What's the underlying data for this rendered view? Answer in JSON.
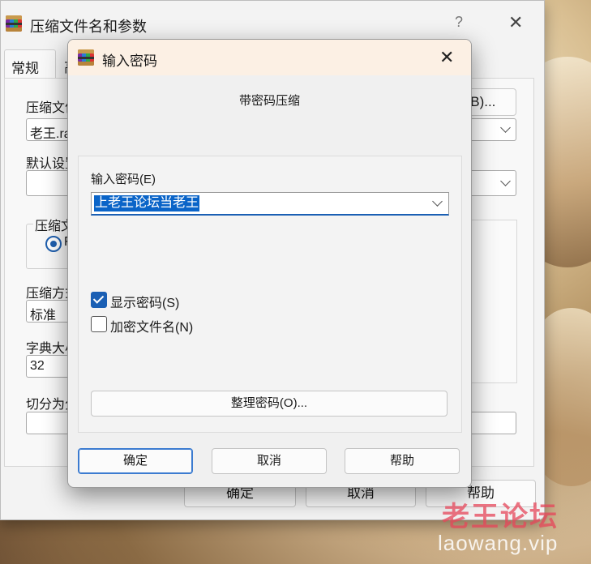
{
  "back_window": {
    "title": "压缩文件名和参数",
    "help_glyph": "?",
    "close_glyph": "✕",
    "tabs": [
      {
        "label": "常规",
        "active": true
      },
      {
        "label": "高",
        "active": false
      }
    ],
    "archive_name_label": "压缩文件",
    "archive_name_value": "老王.ra",
    "browse_button": "(B)...",
    "default_profile_label": "默认设置",
    "format_group_label": "压缩文",
    "format_option_fragment": "F",
    "method_label": "压缩方式",
    "method_value": "标准",
    "dict_label": "字典大小",
    "dict_value": "32",
    "split_label": "切分为分",
    "buttons": {
      "ok": "确定",
      "cancel": "取消",
      "help": "帮助"
    }
  },
  "dialog": {
    "title": "输入密码",
    "close_glyph": "✕",
    "heading": "带密码压缩",
    "password_label": "输入密码(E)",
    "password_value": "上老王论坛当老王",
    "show_password_label": "显示密码(S)",
    "show_password_checked": true,
    "encrypt_names_label": "加密文件名(N)",
    "encrypt_names_checked": false,
    "organize_button": "整理密码(O)...",
    "ok_button": "确定",
    "cancel_button": "取消",
    "help_button": "帮助"
  },
  "watermark": {
    "line1": "老王论坛",
    "line2": "laowang.vip"
  },
  "colors": {
    "accent": "#1a5fb4",
    "selection": "#0a64c8",
    "dialog_titlebar": "#fcf0e4",
    "watermark_red": "#e6465a"
  }
}
